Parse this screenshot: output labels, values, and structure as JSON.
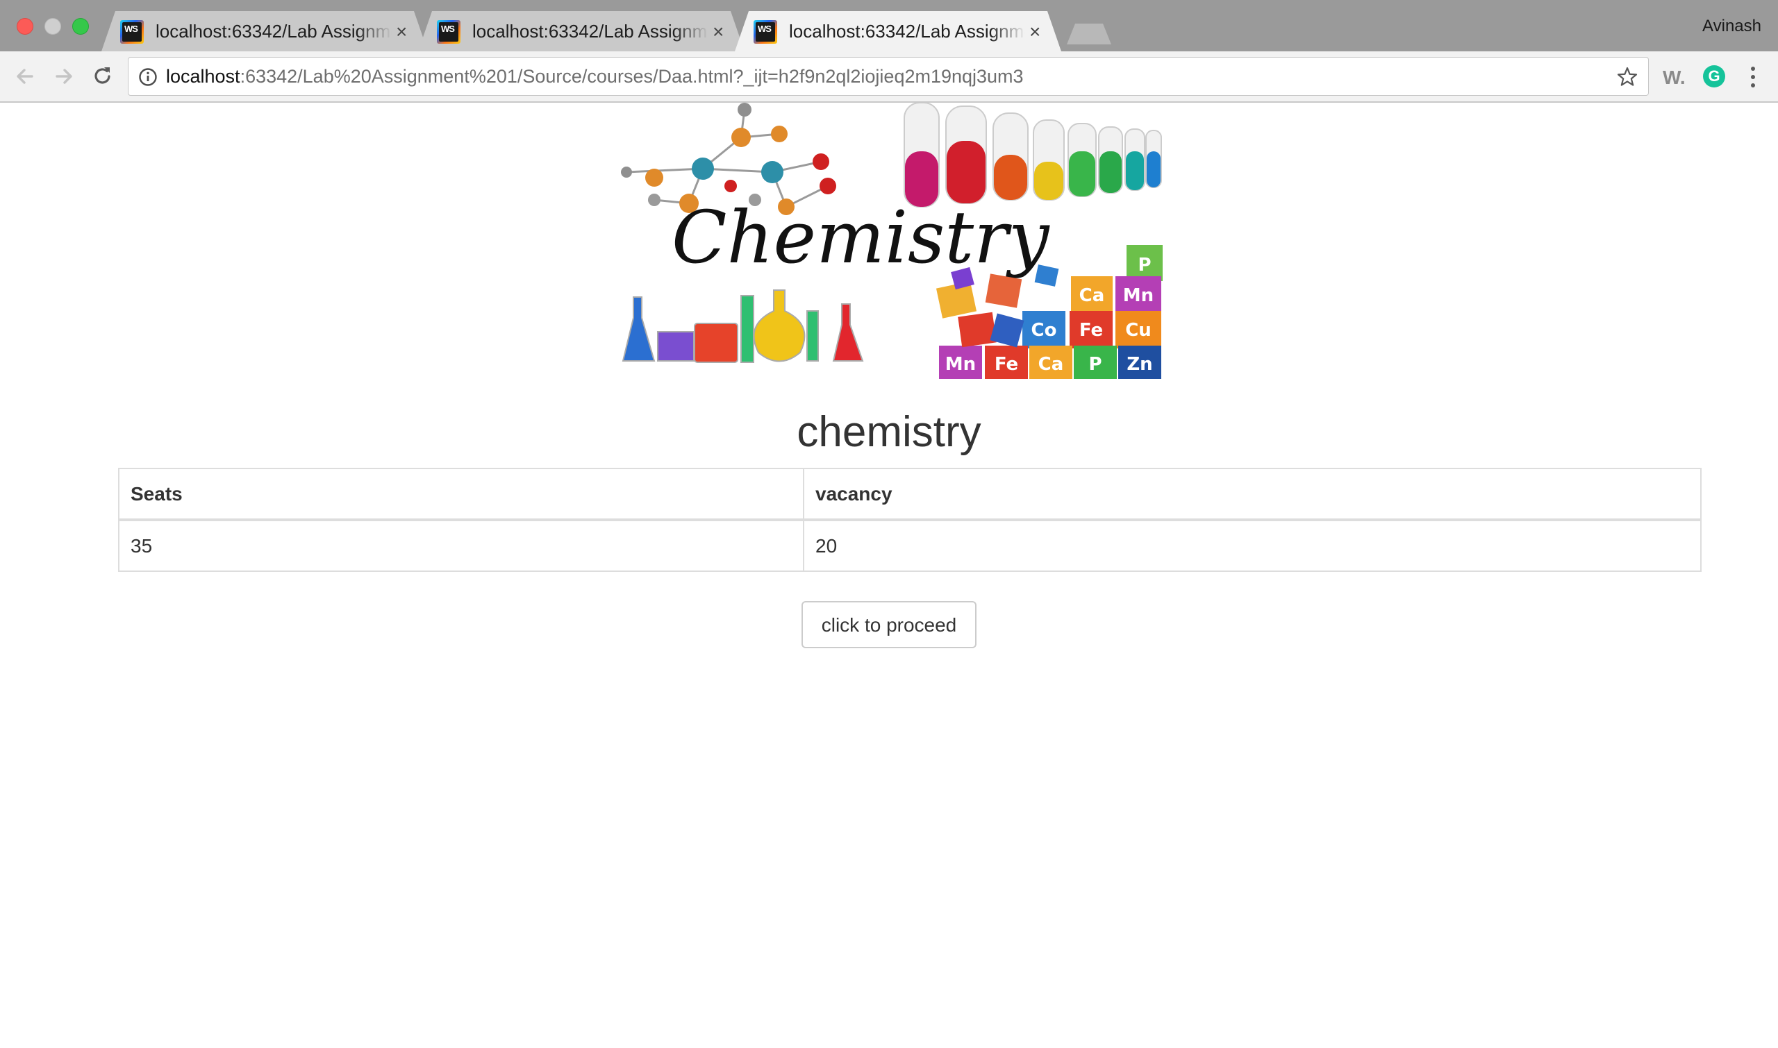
{
  "browser": {
    "tabs": [
      {
        "title": "localhost:63342/Lab Assignment 1",
        "favicon": "webstorm-icon",
        "active": false
      },
      {
        "title": "localhost:63342/Lab Assignment 1",
        "favicon": "webstorm-icon",
        "active": false
      },
      {
        "title": "localhost:63342/Lab Assignment 1",
        "favicon": "webstorm-icon",
        "active": true
      }
    ],
    "profile_name": "Avinash",
    "address": {
      "host": "localhost",
      "rest": ":63342/Lab%20Assignment%201/Source/courses/Daa.html?_ijt=h2f9n2ql2iojieq2m19nqj3um3"
    },
    "favicon_label": "WS",
    "extensions": {
      "w_label": "W.",
      "grammarly_label": "G"
    }
  },
  "page": {
    "banner_text": "Chemistry",
    "title": "chemistry",
    "table": {
      "headers": [
        "Seats",
        "vacancy"
      ],
      "rows": [
        [
          "35",
          "20"
        ]
      ]
    },
    "proceed_label": "click to proceed"
  },
  "colors": {
    "accent_grammarly": "#15c39a",
    "text": "#333333"
  }
}
